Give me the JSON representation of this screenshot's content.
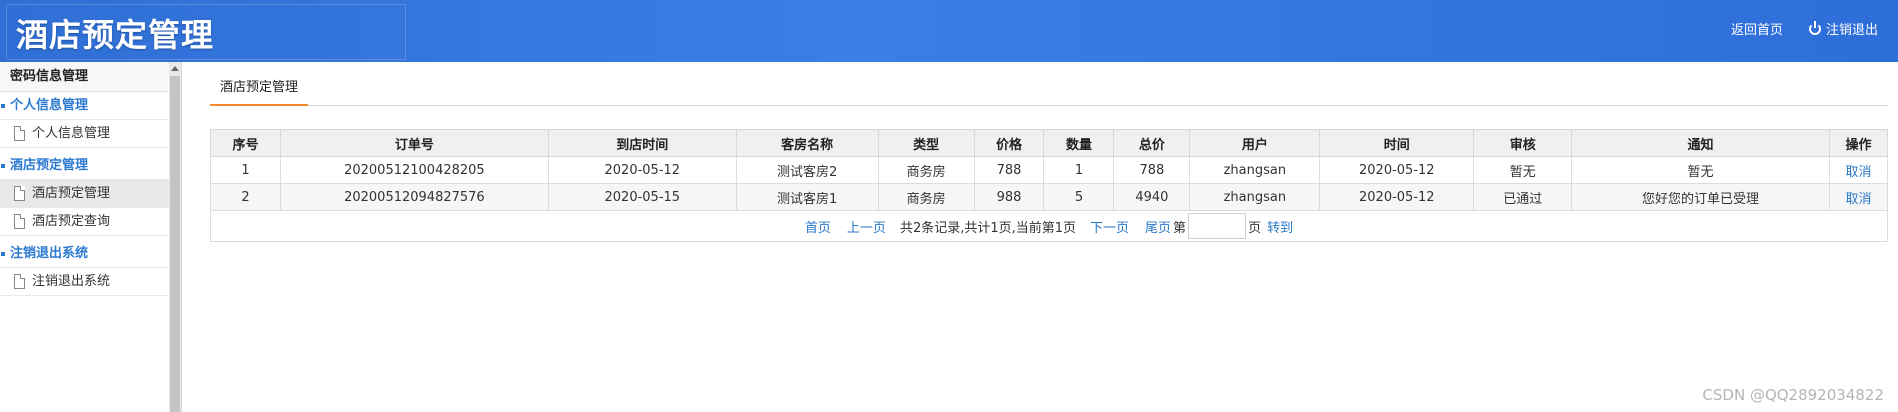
{
  "header": {
    "title": "酒店预定管理",
    "nav_home": "返回首页",
    "nav_logout": "注销退出"
  },
  "sidebar": {
    "heading": "密码信息管理",
    "groups": [
      {
        "label": "个人信息管理",
        "items": [
          {
            "label": "个人信息管理"
          }
        ]
      },
      {
        "label": "酒店预定管理",
        "items": [
          {
            "label": "酒店预定管理"
          },
          {
            "label": "酒店预定查询"
          }
        ]
      },
      {
        "label": "注销退出系统",
        "items": [
          {
            "label": "注销退出系统"
          }
        ]
      }
    ]
  },
  "main": {
    "tab": "酒店预定管理",
    "columns": [
      "序号",
      "订单号",
      "到店时间",
      "客房名称",
      "类型",
      "价格",
      "数量",
      "总价",
      "用户",
      "时间",
      "审核",
      "通知",
      "操作"
    ],
    "rows": [
      [
        "1",
        "20200512100428205",
        "2020-05-12",
        "测试客房2",
        "商务房",
        "788",
        "1",
        "788",
        "zhangsan",
        "2020-05-12",
        "暂无",
        "暂无",
        "取消"
      ],
      [
        "2",
        "20200512094827576",
        "2020-05-15",
        "测试客房1",
        "商务房",
        "988",
        "5",
        "4940",
        "zhangsan",
        "2020-05-12",
        "已通过",
        "您好您的订单已受理",
        "取消"
      ]
    ],
    "pager": {
      "first": "首页",
      "prev": "上一页",
      "info": "共2条记录,共计1页,当前第1页",
      "next": "下一页",
      "last": "尾页",
      "page_prefix": "第",
      "page_input_value": "",
      "page_suffix": "页",
      "go": "转到"
    }
  },
  "watermark": "CSDN @QQ2892034822"
}
